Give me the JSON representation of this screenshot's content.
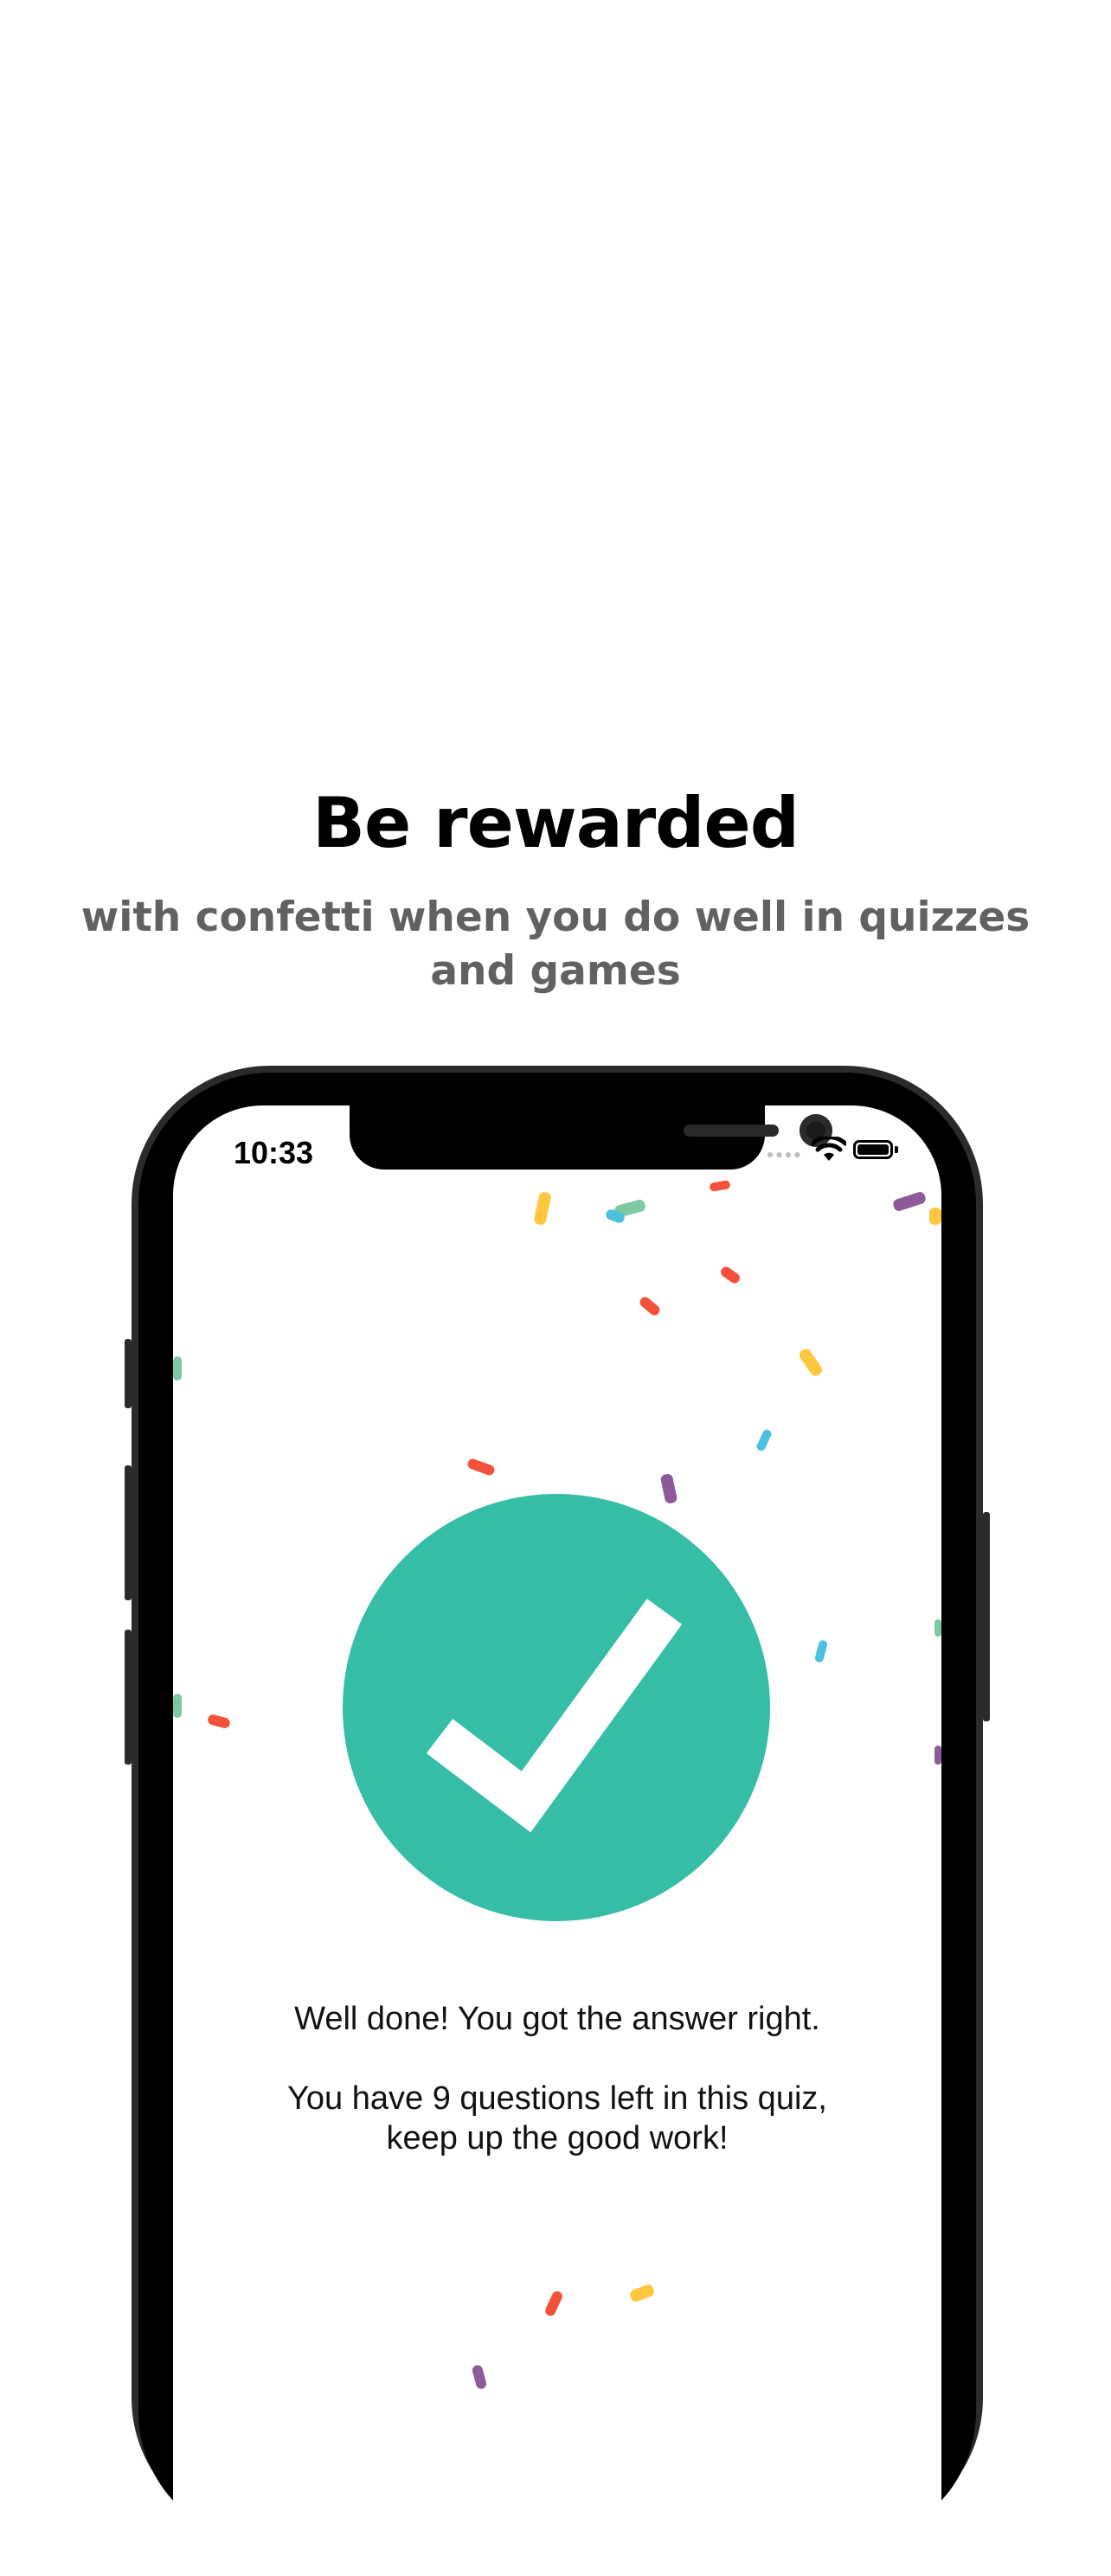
{
  "heading": {
    "title": "Be rewarded",
    "subtitle": "with confetti when you do well in quizzes and games"
  },
  "status_bar": {
    "time": "10:33",
    "icons": [
      "signal-dots-icon",
      "wifi-icon",
      "battery-icon"
    ]
  },
  "result": {
    "icon": "checkmark-icon",
    "accent_color": "#35bda6",
    "message_line1": "Well done! You got the answer right.",
    "message_line2": "You have 9 questions left in this quiz,",
    "message_line3": "keep up the good work!"
  },
  "confetti_colors": [
    "#f4513a",
    "#ffc640",
    "#4bc0e0",
    "#8e5a9a",
    "#7cc9a4"
  ]
}
